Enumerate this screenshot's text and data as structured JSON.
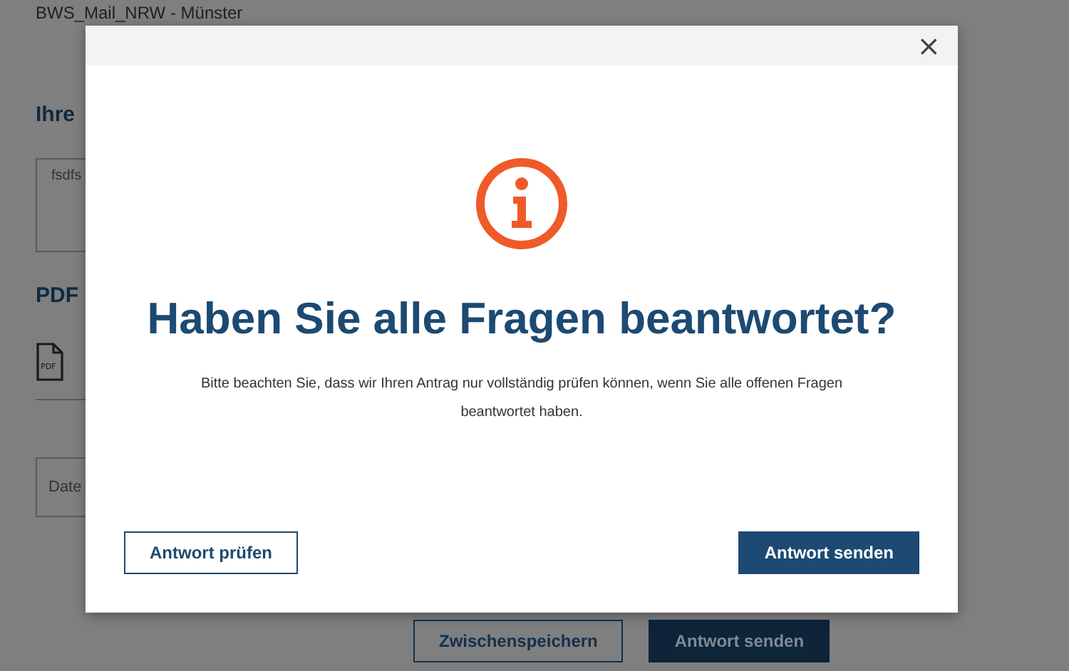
{
  "page": {
    "title": "BWS_Mail_NRW - Münster",
    "section_heading": "Ihre",
    "answer_text": "fsdfs",
    "pdf_heading": "PDF",
    "pdf_icon_label": "PDF",
    "date_field": "Date",
    "buttons": [
      {
        "label": "Zwischenspeichern",
        "kind": "secondary"
      },
      {
        "label": "Antwort senden",
        "kind": "primary"
      }
    ]
  },
  "dialog": {
    "close": "×",
    "heading": "Haben Sie alle Fragen beantwortet?",
    "message": "Bitte beachten Sie, dass wir Ihren Antrag nur vollständig prüfen können, wenn Sie alle offenen Fragen beantwortet haben.",
    "buttons": [
      {
        "label": "Antwort prüfen",
        "kind": "secondary"
      },
      {
        "label": "Antwort senden",
        "kind": "primary"
      }
    ]
  }
}
